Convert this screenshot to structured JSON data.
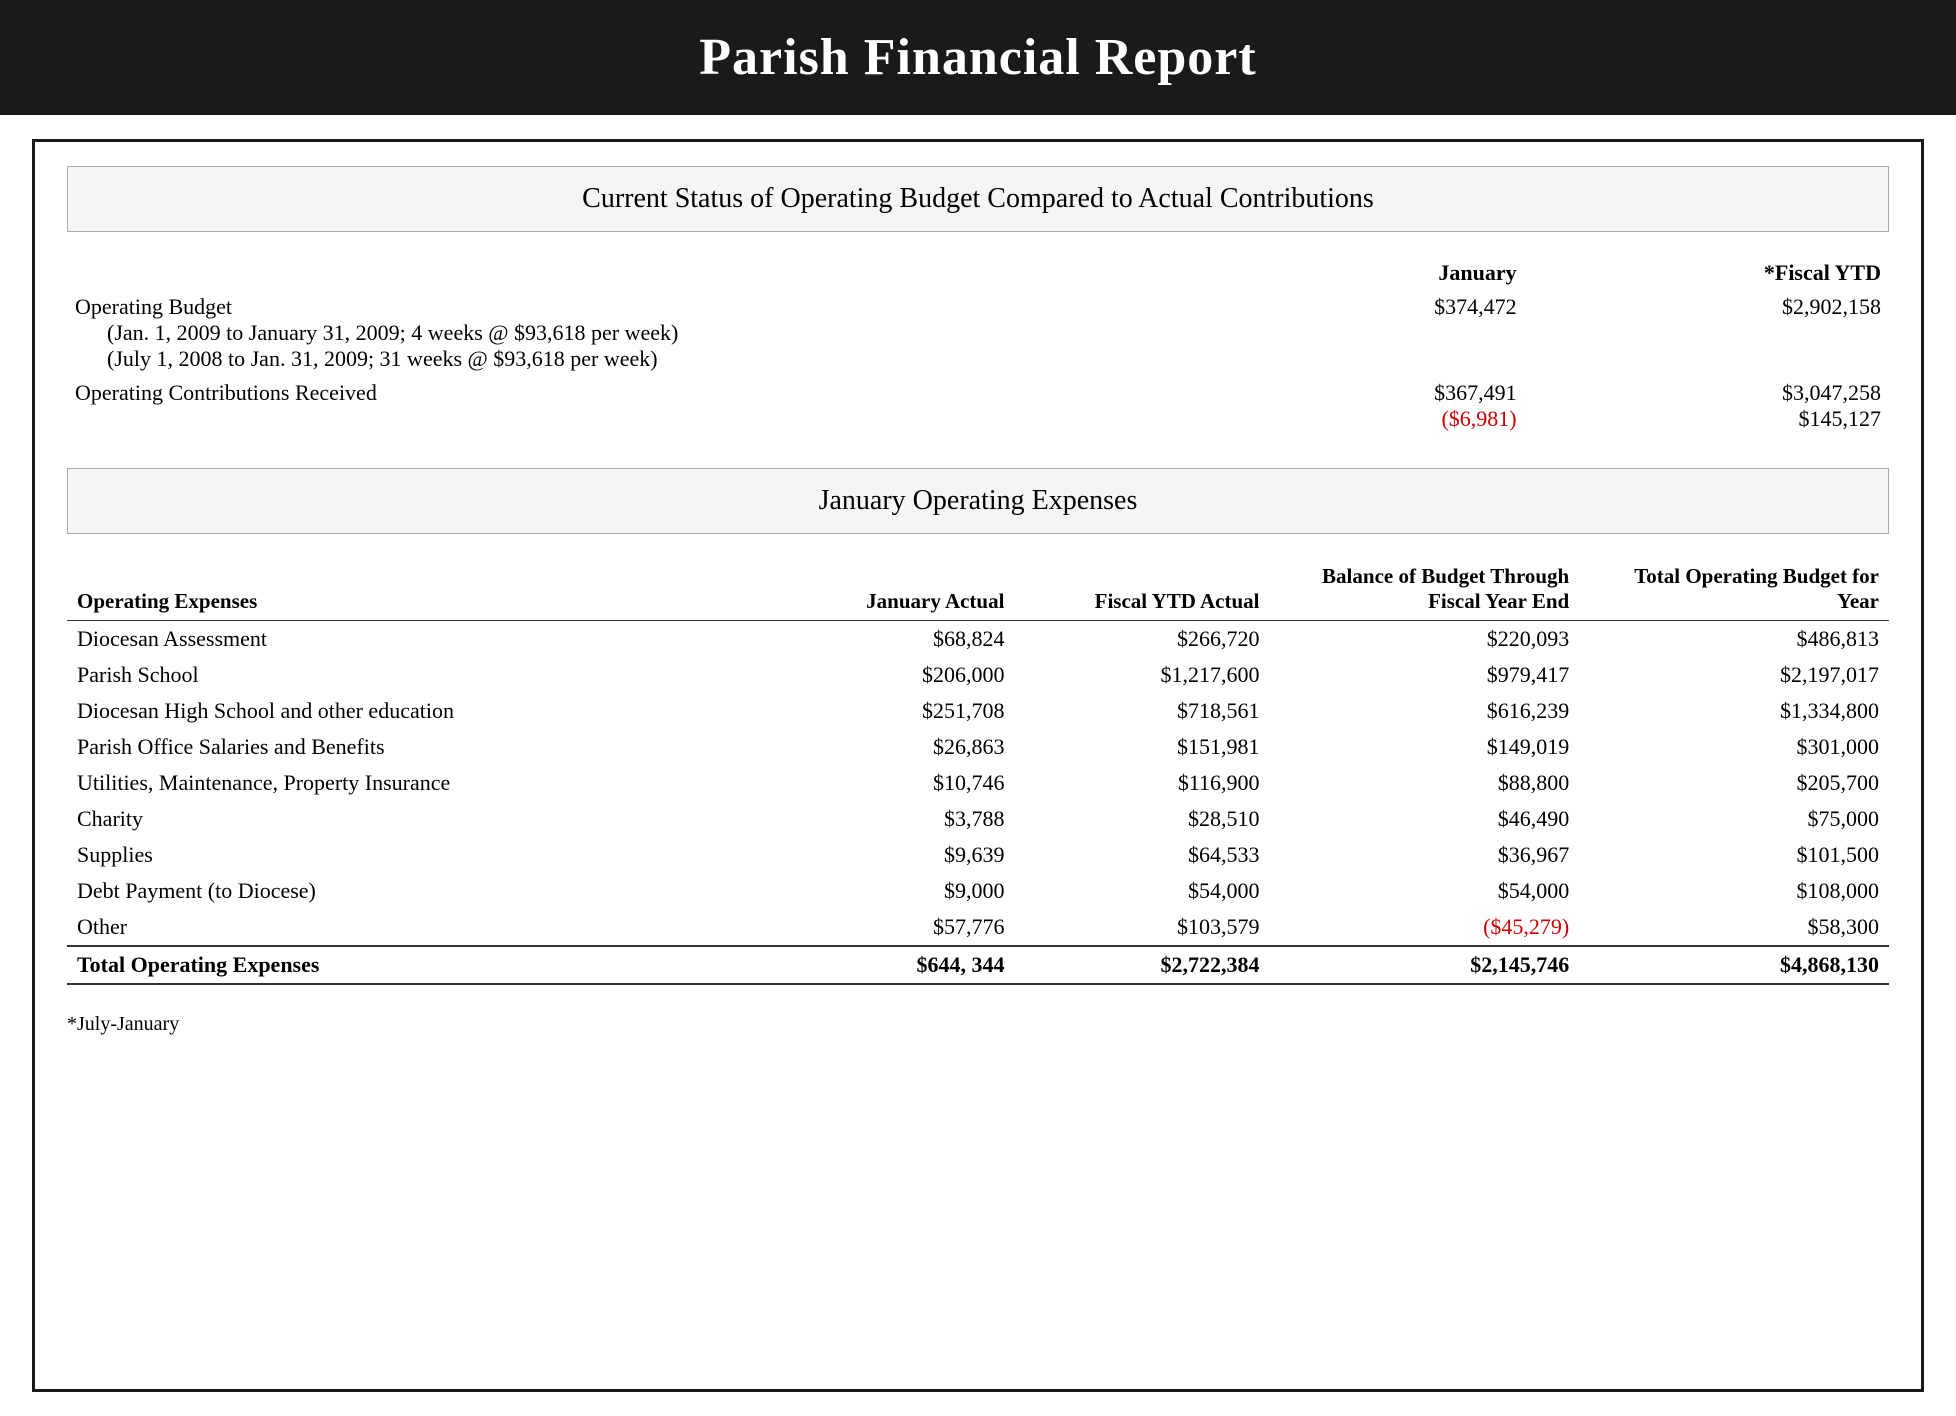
{
  "header": {
    "title": "Parish Financial Report"
  },
  "section1": {
    "title": "Current Status of Operating Budget Compared to Actual Contributions",
    "col_jan_header": "January",
    "col_ytd_header": "*Fiscal YTD",
    "rows": [
      {
        "label": "Operating Budget",
        "sub_label_1": "(Jan. 1, 2009 to January 31, 2009; 4 weeks @ $93,618 per week)",
        "sub_label_2": "(July 1, 2008 to Jan. 31, 2009; 31 weeks @ $93,618 per week)",
        "jan": "$374,472",
        "ytd": "$2,902,158"
      },
      {
        "label": "Operating Contributions Received",
        "jan_1": "$367,491",
        "jan_2": "($6,981)",
        "ytd_1": "$3,047,258",
        "ytd_2": "$145,127"
      }
    ]
  },
  "section2": {
    "title": "January Operating Expenses",
    "col_label": "Operating Expenses",
    "col_jan": "January Actual",
    "col_ytd": "Fiscal YTD Actual",
    "col_bal": "Balance of Budget Through Fiscal Year End",
    "col_total": "Total Operating Budget for Year",
    "rows": [
      {
        "label": "Diocesan Assessment",
        "jan": "$68,824",
        "ytd": "$266,720",
        "bal": "$220,093",
        "total": "$486,813"
      },
      {
        "label": "Parish School",
        "jan": "$206,000",
        "ytd": "$1,217,600",
        "bal": "$979,417",
        "total": "$2,197,017"
      },
      {
        "label": "Diocesan High School and other education",
        "jan": "$251,708",
        "ytd": "$718,561",
        "bal": "$616,239",
        "total": "$1,334,800"
      },
      {
        "label": "Parish Office Salaries and Benefits",
        "jan": "$26,863",
        "ytd": "$151,981",
        "bal": "$149,019",
        "total": "$301,000"
      },
      {
        "label": "Utilities, Maintenance, Property Insurance",
        "jan": "$10,746",
        "ytd": "$116,900",
        "bal": "$88,800",
        "total": "$205,700"
      },
      {
        "label": "Charity",
        "jan": "$3,788",
        "ytd": "$28,510",
        "bal": "$46,490",
        "total": "$75,000"
      },
      {
        "label": "Supplies",
        "jan": "$9,639",
        "ytd": "$64,533",
        "bal": "$36,967",
        "total": "$101,500"
      },
      {
        "label": "Debt Payment (to Diocese)",
        "jan": "$9,000",
        "ytd": "$54,000",
        "bal": "$54,000",
        "total": "$108,000"
      },
      {
        "label": "Other",
        "jan": "$57,776",
        "ytd": "$103,579",
        "bal": "($45,279)",
        "bal_red": true,
        "total": "$58,300"
      }
    ],
    "total_row": {
      "label": "Total Operating Expenses",
      "jan": "$644, 344",
      "ytd": "$2,722,384",
      "bal": "$2,145,746",
      "total": "$4,868,130"
    },
    "footnote": "*July-January"
  }
}
